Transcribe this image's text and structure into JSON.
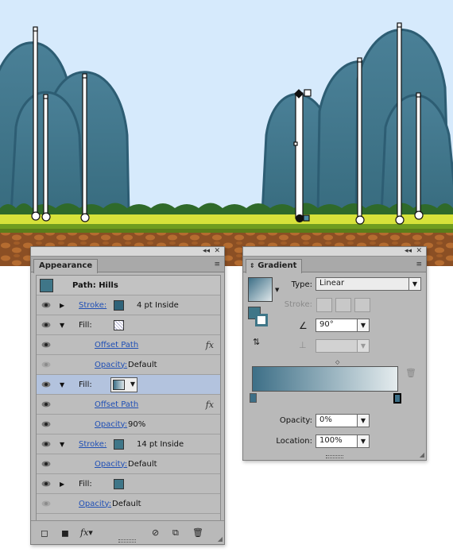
{
  "appearance": {
    "tab": "Appearance",
    "path_title": "Path: Hills",
    "rows": [
      {
        "label": "Stroke:",
        "value": "4 pt  Inside"
      },
      {
        "label": "Fill:"
      },
      {
        "label": "Offset Path"
      },
      {
        "label": "Opacity:",
        "value": "Default"
      },
      {
        "label": "Fill:"
      },
      {
        "label": "Offset Path"
      },
      {
        "label": "Opacity:",
        "value": "90%"
      },
      {
        "label": "Stroke:",
        "value": "14 pt  Inside"
      },
      {
        "label": "Opacity:",
        "value": "Default"
      },
      {
        "label": "Fill:"
      },
      {
        "label": "Opacity:",
        "value": "Default"
      }
    ],
    "fx_label": "fx"
  },
  "gradient": {
    "tab": "Gradient",
    "type_label": "Type:",
    "type_value": "Linear",
    "stroke_label": "Stroke:",
    "angle_value": "90°",
    "opacity_label": "Opacity:",
    "opacity_value": "0%",
    "location_label": "Location:",
    "location_value": "100%"
  },
  "colors": {
    "sky": "#d6eafc",
    "hill": "#40788a",
    "hill_stroke": "#2d5d73",
    "grass": "#a6cc2a",
    "dirt": "#a2602b",
    "gradient_start": "#3d6f87"
  }
}
